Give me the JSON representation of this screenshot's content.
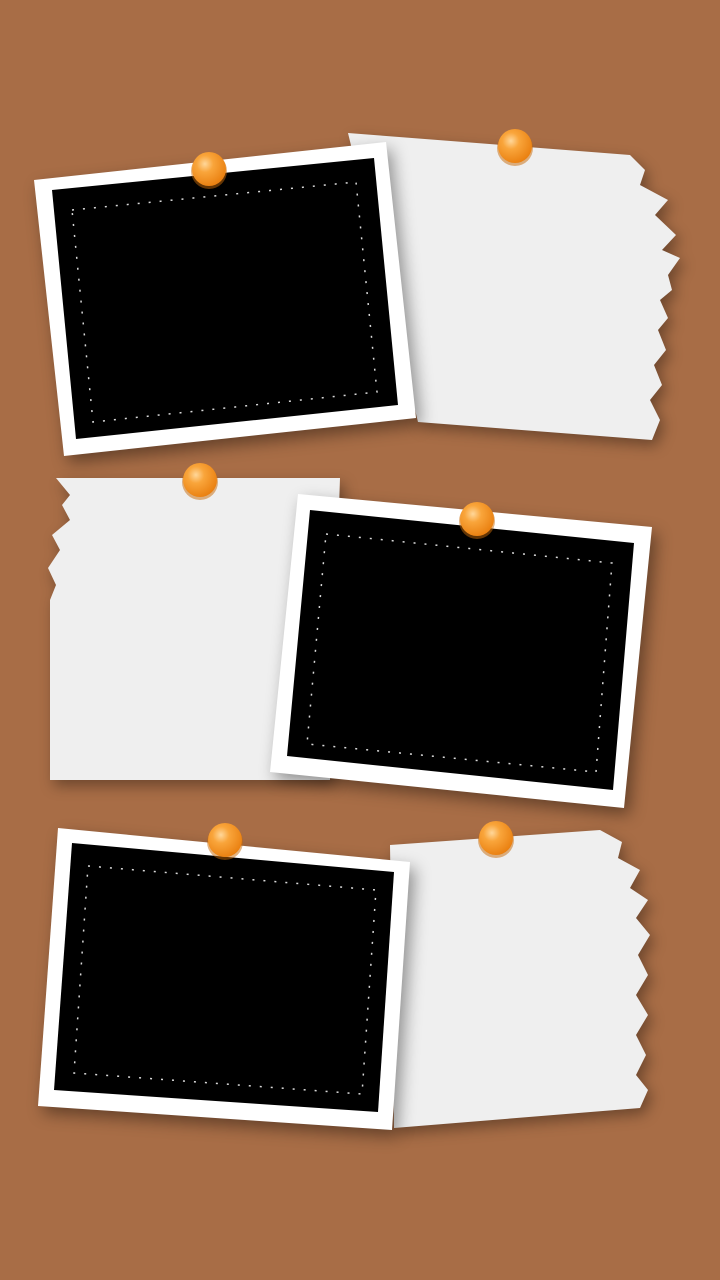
{
  "board": {
    "background_color": "#a86d46"
  },
  "colors": {
    "paper": "#efefef",
    "photo_border": "#ffffff",
    "photo_window": "#000000",
    "pin": "#f7941d",
    "pin_highlight": "#fdd08a"
  },
  "rows": [
    {
      "photo_side": "left",
      "paper_side": "right"
    },
    {
      "photo_side": "right",
      "paper_side": "left"
    },
    {
      "photo_side": "left",
      "paper_side": "right"
    }
  ],
  "icons": {
    "pin": "pushpin-icon"
  }
}
